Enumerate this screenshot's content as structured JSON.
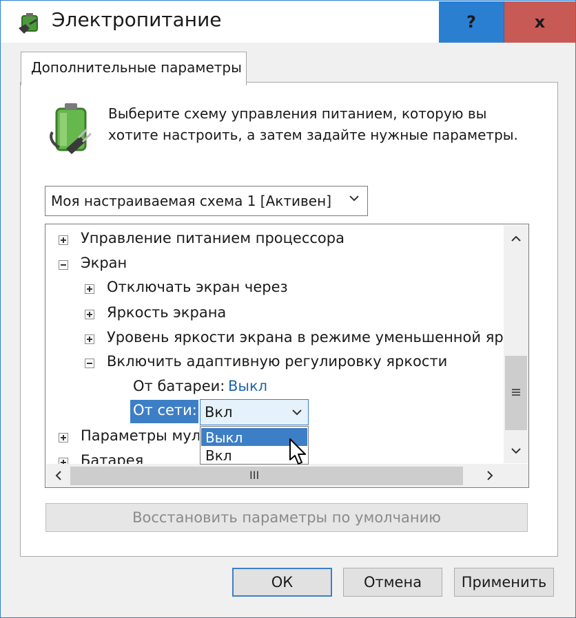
{
  "window": {
    "title": "Электропитание",
    "help_label": "?",
    "close_label": "x"
  },
  "tab": {
    "label": "Дополнительные параметры"
  },
  "description": "Выберите схему управления питанием, которую вы хотите настроить, а затем задайте нужные параметры.",
  "plan_select": {
    "value": "Моя настраиваемая схема 1 [Активен]"
  },
  "tree": {
    "items": [
      {
        "label": "Управление питанием процессора",
        "state": "collapsed"
      },
      {
        "label": "Экран",
        "state": "expanded"
      },
      {
        "label": "Отключать экран через",
        "state": "collapsed"
      },
      {
        "label": "Яркость экрана",
        "state": "collapsed"
      },
      {
        "label": "Уровень яркости экрана в режиме уменьшенной яр",
        "state": "collapsed"
      },
      {
        "label": "Включить адаптивную регулировку яркости",
        "state": "expanded"
      },
      {
        "label": "Параметры мул",
        "state": "collapsed"
      },
      {
        "label": "Батарея",
        "state": "collapsed"
      }
    ],
    "battery": {
      "label": "От батареи:",
      "value": "Выкл"
    },
    "ac": {
      "label": "От сети:",
      "value": "Вкл"
    },
    "dropdown_options": [
      "Выкл",
      "Вкл"
    ],
    "scroll_grip": "III"
  },
  "restore_button": "Восстановить параметры по умолчанию",
  "buttons": {
    "ok": "ОК",
    "cancel": "Отмена",
    "apply": "Применить"
  },
  "colors": {
    "accent": "#2b7fd1",
    "close": "#c85a56",
    "selection": "#3d7fc6",
    "link": "#1f64b0"
  },
  "icons": [
    "power-options-icon",
    "battery-plug-icon",
    "chevron-down-icon",
    "chevron-up-icon",
    "chevron-left-icon",
    "chevron-right-icon",
    "mouse-cursor-icon"
  ]
}
